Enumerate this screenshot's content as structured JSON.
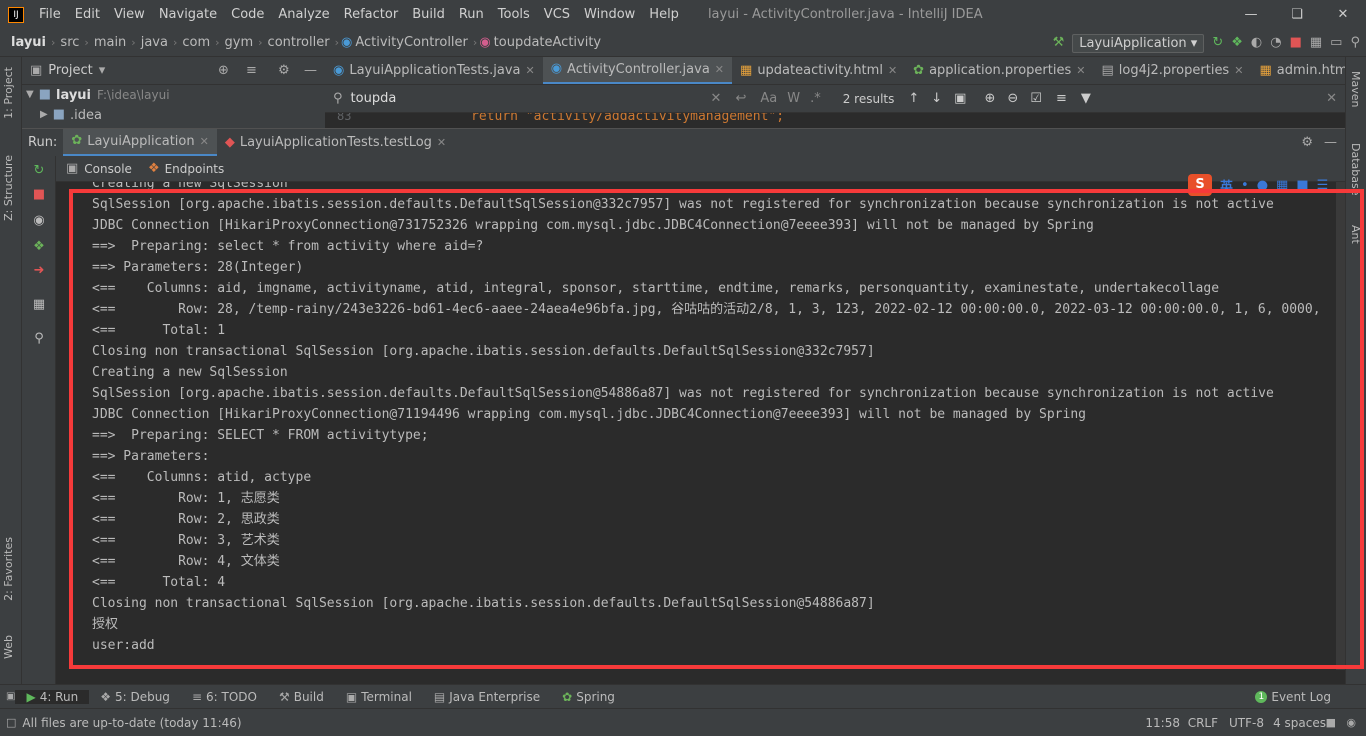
{
  "app": {
    "logo": "IJ",
    "title": "layui - ActivityController.java - IntelliJ IDEA",
    "menu": [
      "File",
      "Edit",
      "View",
      "Navigate",
      "Code",
      "Analyze",
      "Refactor",
      "Build",
      "Run",
      "Tools",
      "VCS",
      "Window",
      "Help"
    ]
  },
  "breadcrumb": [
    "layui",
    "src",
    "main",
    "java",
    "com",
    "gym",
    "controller",
    "ActivityController",
    "toupdateActivity"
  ],
  "run_config": "LayuiApplication",
  "project": {
    "header": "Project",
    "root_name": "layui",
    "root_path": "F:\\idea\\layui",
    "child": ".idea"
  },
  "left_tabs": [
    "1: Project",
    "Z: Structure",
    "2: Favorites",
    "Web"
  ],
  "right_tabs": [
    "Maven",
    "Database",
    "Ant"
  ],
  "editor_tabs": [
    {
      "label": "LayuiApplicationTests.java",
      "active": false
    },
    {
      "label": "ActivityController.java",
      "active": true
    },
    {
      "label": "updateactivity.html",
      "active": false
    },
    {
      "label": "application.properties",
      "active": false
    },
    {
      "label": "log4j2.properties",
      "active": false
    },
    {
      "label": "admin.html",
      "active": false
    }
  ],
  "find": {
    "query": "toupda",
    "results": "2 results",
    "case_btn": "Aa",
    "word_btn": "W",
    "regex_btn": ".*"
  },
  "code_peek": {
    "line_no": "83",
    "code": "return \"activity/addactivitymanagement\";"
  },
  "run_panel": {
    "label": "Run:",
    "tabs": [
      {
        "label": "LayuiApplication",
        "active": true
      },
      {
        "label": "LayuiApplicationTests.testLog",
        "active": false
      }
    ],
    "subtabs": [
      "Console",
      "Endpoints"
    ]
  },
  "ime": {
    "badge": "S",
    "lang": "英"
  },
  "console_lines": [
    "Creating a new SqlSession",
    "SqlSession [org.apache.ibatis.session.defaults.DefaultSqlSession@332c7957] was not registered for synchronization because synchronization is not active",
    "JDBC Connection [HikariProxyConnection@731752326 wrapping com.mysql.jdbc.JDBC4Connection@7eeee393] will not be managed by Spring",
    "==>  Preparing: select * from activity where aid=?",
    "==> Parameters: 28(Integer)",
    "<==    Columns: aid, imgname, activityname, atid, integral, sponsor, starttime, endtime, remarks, personquantity, examinestate, undertakecollage",
    "<==        Row: 28, /temp-rainy/243e3226-bd61-4ec6-aaee-24aea4e96bfa.jpg, 谷咕咕的活动2/8, 1, 3, 123, 2022-02-12 00:00:00.0, 2022-03-12 00:00:00.0, 1, 6, 0000,",
    "<==      Total: 1",
    "Closing non transactional SqlSession [org.apache.ibatis.session.defaults.DefaultSqlSession@332c7957]",
    "Creating a new SqlSession",
    "SqlSession [org.apache.ibatis.session.defaults.DefaultSqlSession@54886a87] was not registered for synchronization because synchronization is not active",
    "JDBC Connection [HikariProxyConnection@71194496 wrapping com.mysql.jdbc.JDBC4Connection@7eeee393] will not be managed by Spring",
    "==>  Preparing: SELECT * FROM activitytype;",
    "==> Parameters: ",
    "<==    Columns: atid, actype",
    "<==        Row: 1, 志愿类",
    "<==        Row: 2, 思政类",
    "<==        Row: 3, 艺术类",
    "<==        Row: 4, 文体类",
    "<==      Total: 4",
    "Closing non transactional SqlSession [org.apache.ibatis.session.defaults.DefaultSqlSession@54886a87]",
    "授权",
    "user:add"
  ],
  "tool_windows": [
    {
      "label": "4: Run",
      "active": true
    },
    {
      "label": "5: Debug",
      "active": false
    },
    {
      "label": "6: TODO",
      "active": false
    },
    {
      "label": "Build",
      "active": false
    },
    {
      "label": "Terminal",
      "active": false
    },
    {
      "label": "Java Enterprise",
      "active": false
    },
    {
      "label": "Spring",
      "active": false
    }
  ],
  "event_log": "Event Log",
  "status": {
    "message": "All files are up-to-date (today 11:46)",
    "position": "11:58",
    "line_sep": "CRLF",
    "encoding": "UTF-8",
    "indent": "4 spaces"
  },
  "colors": {
    "accent": "#4a88c7",
    "highlight_box": "#f63a3a",
    "bg": "#2b2b2b",
    "panel": "#3c3f41"
  }
}
